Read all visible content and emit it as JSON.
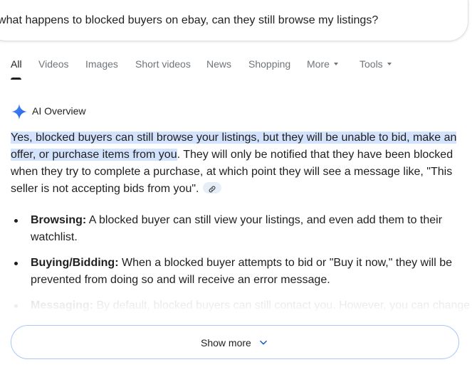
{
  "search": {
    "query": "what happens to blocked buyers on ebay, can they still browse my listings?"
  },
  "tabs": [
    {
      "label": "All",
      "active": true
    },
    {
      "label": "Videos"
    },
    {
      "label": "Images"
    },
    {
      "label": "Short videos"
    },
    {
      "label": "News"
    },
    {
      "label": "Shopping"
    },
    {
      "label": "More",
      "has_caret": true
    },
    {
      "label": "Tools",
      "has_caret": true
    }
  ],
  "ai_overview": {
    "label": "AI Overview",
    "icon": "sparkle-icon",
    "highlighted": "Yes, blocked buyers can still browse your listings, but they will be unable to bid, make an offer, or purchase items from you",
    "rest": ". They will only be notified that they have been blocked when they try to complete a purchase, at which point they will see a message like, \"This seller is not accepting bids from you\".",
    "citation_icon": "link-icon",
    "bullets": [
      {
        "term": "Browsing:",
        "text": " A blocked buyer can still view your listings, and even add them to their watchlist."
      },
      {
        "term": "Buying/Bidding:",
        "text": " When a blocked buyer attempts to bid or \"Buy it now,\" they will be prevented from doing so and will receive an error message."
      },
      {
        "term": "Messaging:",
        "text": " By default, blocked buyers can still contact you. However, you can change"
      }
    ]
  },
  "show_more": {
    "label": "Show more",
    "icon": "chevron-down-icon"
  },
  "colors": {
    "highlight": "#d3e3fd",
    "show_more_border": "#a8c7fa",
    "tab_inactive": "#70757a",
    "sparkle": "#4285f4"
  }
}
